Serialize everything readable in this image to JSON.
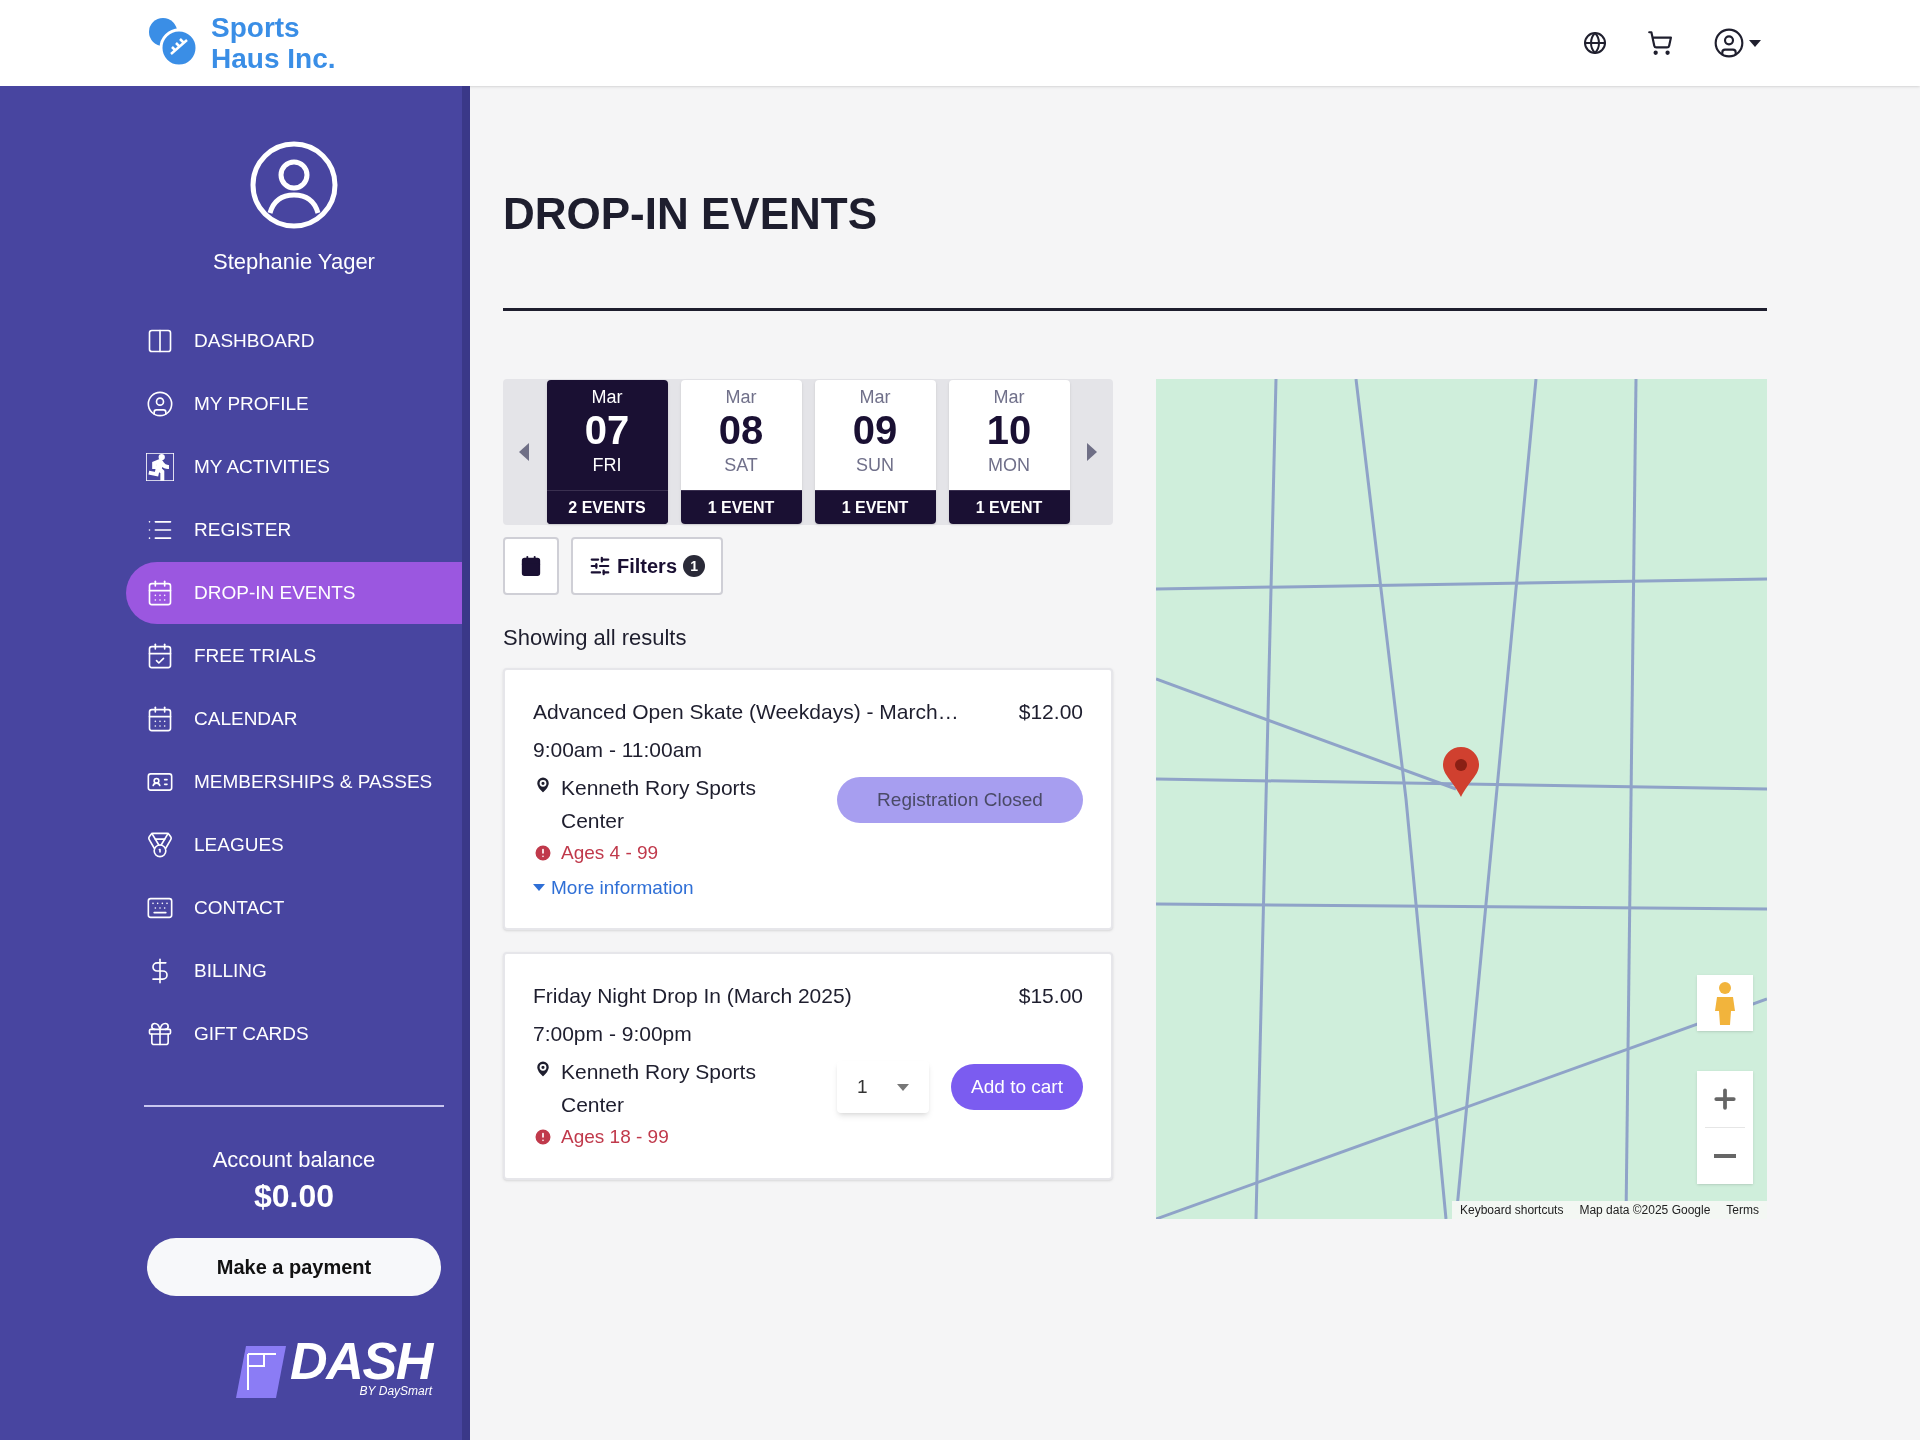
{
  "header": {
    "brand": "Sports Haus Inc."
  },
  "sidebar": {
    "user_name": "Stephanie Yager",
    "nav": [
      {
        "label": "DASHBOARD",
        "selected": false
      },
      {
        "label": "MY PROFILE",
        "selected": false
      },
      {
        "label": "MY ACTIVITIES",
        "selected": false
      },
      {
        "label": "REGISTER",
        "selected": false
      },
      {
        "label": "DROP-IN EVENTS",
        "selected": true
      },
      {
        "label": "FREE TRIALS",
        "selected": false
      },
      {
        "label": "CALENDAR",
        "selected": false
      },
      {
        "label": "MEMBERSHIPS & PASSES",
        "selected": false
      },
      {
        "label": "LEAGUES",
        "selected": false
      },
      {
        "label": "CONTACT",
        "selected": false
      },
      {
        "label": "BILLING",
        "selected": false
      },
      {
        "label": "GIFT CARDS",
        "selected": false
      }
    ],
    "balance_label": "Account balance",
    "balance": "$0.00",
    "payment_button": "Make a payment",
    "footer_logo": {
      "wordmark": "DASH",
      "byline": "BY DaySmart"
    }
  },
  "page_title": "DROP-IN EVENTS",
  "dates": [
    {
      "month": "Mar",
      "day": "07",
      "weekday": "FRI",
      "events": "2 EVENTS",
      "selected": true
    },
    {
      "month": "Mar",
      "day": "08",
      "weekday": "SAT",
      "events": "1 EVENT",
      "selected": false
    },
    {
      "month": "Mar",
      "day": "09",
      "weekday": "SUN",
      "events": "1 EVENT",
      "selected": false
    },
    {
      "month": "Mar",
      "day": "10",
      "weekday": "MON",
      "events": "1 EVENT",
      "selected": false
    }
  ],
  "filters": {
    "label": "Filters",
    "count": "1"
  },
  "results_text": "Showing all results",
  "events": [
    {
      "title": "Advanced Open Skate (Weekdays) - March…",
      "price": "$12.00",
      "time": "9:00am - 11:00am",
      "venue": "Kenneth Rory Sports Center",
      "ages": "Ages 4 - 99",
      "more_link": "More information",
      "action": {
        "kind": "closed",
        "label": "Registration Closed"
      }
    },
    {
      "title": "Friday Night Drop In (March 2025)",
      "price": "$15.00",
      "time": "7:00pm - 9:00pm",
      "venue": "Kenneth Rory Sports Center",
      "ages": "Ages 18 - 99",
      "quantity": "1",
      "action": {
        "kind": "cart",
        "label": "Add to cart"
      }
    }
  ],
  "map": {
    "attribution": [
      "Keyboard shortcuts",
      "Map data ©2025 Google",
      "Terms"
    ]
  }
}
